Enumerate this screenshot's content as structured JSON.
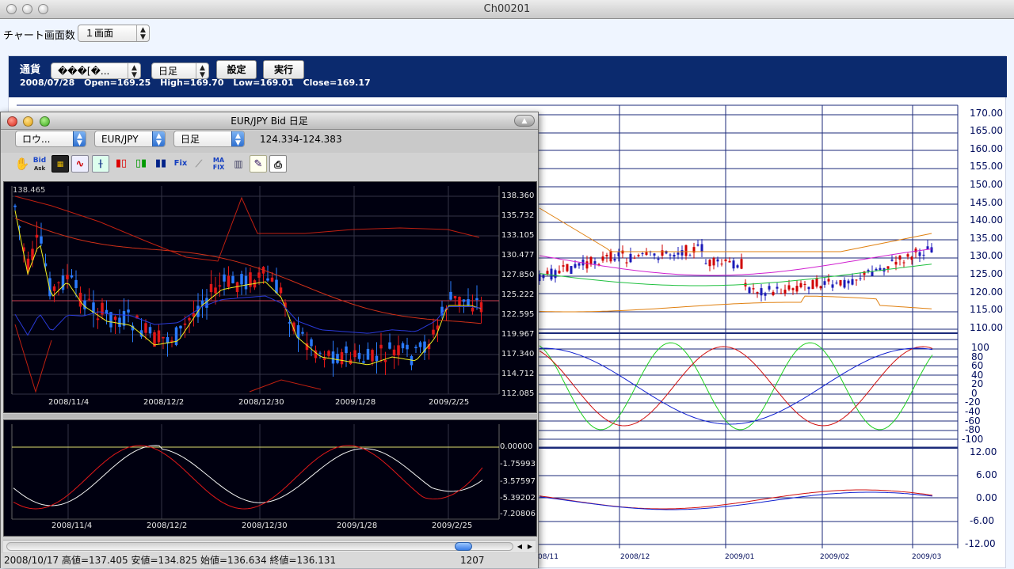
{
  "window": {
    "title": "Ch00201"
  },
  "toolbar": {
    "screens_label": "チャート画面数",
    "screens_value": "１画面"
  },
  "main_panel": {
    "currency_label": "通貨",
    "currency_value": "���[�...",
    "period_value": "日足",
    "settings_button": "設定",
    "run_button": "実行",
    "ohlc": {
      "date": "2008/07/28",
      "open": "Open=169.25",
      "high": "High=169.70",
      "low": "Low=169.01",
      "close": "Close=169.17"
    },
    "price_axis": [
      "170.00",
      "165.00",
      "160.00",
      "155.00",
      "150.00",
      "145.00",
      "140.00",
      "135.00",
      "130.00",
      "125.00",
      "120.00",
      "115.00",
      "110.00"
    ],
    "stoch_axis": [
      "100",
      "80",
      "60",
      "40",
      "20",
      "0",
      "-20",
      "-40",
      "-60",
      "-80",
      "-100"
    ],
    "macd_axis": [
      "12.00",
      "6.00",
      "0.00",
      "-6.00",
      "-12.00"
    ],
    "date_labels": [
      "08/11",
      "2008/12",
      "2009/01",
      "2009/02",
      "2009/03"
    ]
  },
  "inner_window": {
    "title": "EUR/JPY Bid 日足",
    "chart_type_select": "ロウ...",
    "pair_select": "EUR/JPY",
    "period_select": "日足",
    "quote": "124.334-124.383",
    "tools": [
      "hand-icon",
      "bid-ask-icon",
      "grid-icon",
      "wave-icon",
      "candle-icon",
      "candlestick-red-icon",
      "candlestick-green-icon",
      "candlestick-blue-icon",
      "fix-icon",
      "slope-icon",
      "max-fix-icon",
      "bar-chart-icon",
      "pencil-icon",
      "print-icon"
    ],
    "max_label": "138.465",
    "price_axis": [
      "138.360",
      "135.732",
      "133.105",
      "130.477",
      "127.850",
      "125.222",
      "122.595",
      "119.967",
      "117.340",
      "114.712",
      "112.085"
    ],
    "date_labels": [
      "2008/11/4",
      "2008/12/2",
      "2008/12/30",
      "2009/1/28",
      "2009/2/25"
    ],
    "macd_axis": [
      "0.00000",
      "-1.75993",
      "-3.57597",
      "-5.39202",
      "-7.20806"
    ],
    "status": "2008/10/17  高値=137.405 安値=134.825 始値=136.634 終値=136.131",
    "count": "1207"
  },
  "colors": {
    "navy": "#0b2a6e",
    "chart_bg": "#000010",
    "up": "#e00000",
    "down": "#1b1bb8"
  }
}
